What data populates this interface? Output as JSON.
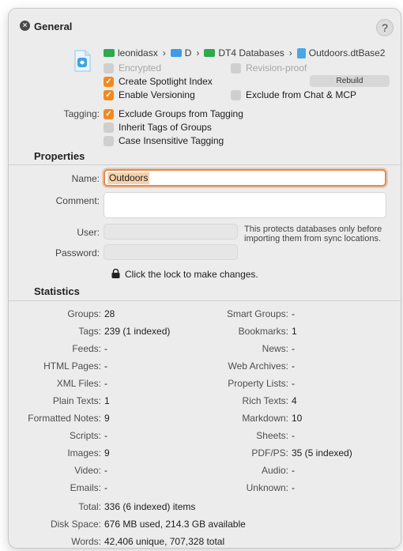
{
  "header": {
    "title": "General",
    "help": "?",
    "close": "×"
  },
  "path": {
    "items": [
      "leonidasx",
      "D",
      "DT4 Databases",
      "Outdoors.dtBase2"
    ],
    "separator": "›",
    "folder_colors": {
      "green": "#2fa84f",
      "blue": "#3d9be8"
    }
  },
  "options": {
    "encrypted": {
      "label": "Encrypted",
      "checked": false,
      "enabled": false
    },
    "revision_proof": {
      "label": "Revision-proof",
      "checked": false,
      "enabled": false
    },
    "spotlight": {
      "label": "Create Spotlight Index",
      "checked": true
    },
    "rebuild": "Rebuild",
    "versioning": {
      "label": "Enable Versioning",
      "checked": true
    },
    "exclude_chat": {
      "label": "Exclude from Chat & MCP",
      "checked": false
    }
  },
  "tagging": {
    "label": "Tagging:",
    "exclude_groups": {
      "label": "Exclude Groups from Tagging",
      "checked": true
    },
    "inherit_tags": {
      "label": "Inherit Tags of Groups",
      "checked": false
    },
    "case_insensitive": {
      "label": "Case Insensitive Tagging",
      "checked": false
    }
  },
  "properties": {
    "title": "Properties",
    "name_label": "Name:",
    "name_value": "Outdoors",
    "comment_label": "Comment:",
    "comment_value": "",
    "user_label": "User:",
    "password_label": "Password:",
    "note": "This protects databases only before importing them from sync locations.",
    "lock_text": "Click the lock to make changes."
  },
  "statistics": {
    "title": "Statistics",
    "left": [
      {
        "label": "Groups:",
        "value": "28"
      },
      {
        "label": "Tags:",
        "value": "239 (1 indexed)"
      },
      {
        "label": "Feeds:",
        "value": "-"
      },
      {
        "label": "HTML Pages:",
        "value": "-"
      },
      {
        "label": "XML Files:",
        "value": "-"
      },
      {
        "label": "Plain Texts:",
        "value": "1"
      },
      {
        "label": "Formatted Notes:",
        "value": "9"
      },
      {
        "label": "Scripts:",
        "value": "-"
      },
      {
        "label": "Images:",
        "value": "9"
      },
      {
        "label": "Video:",
        "value": "-"
      },
      {
        "label": "Emails:",
        "value": "-"
      }
    ],
    "right": [
      {
        "label": "Smart Groups:",
        "value": "-"
      },
      {
        "label": "Bookmarks:",
        "value": "1"
      },
      {
        "label": "News:",
        "value": "-"
      },
      {
        "label": "Web Archives:",
        "value": "-"
      },
      {
        "label": "Property Lists:",
        "value": "-"
      },
      {
        "label": "Rich Texts:",
        "value": "4"
      },
      {
        "label": "Markdown:",
        "value": "10"
      },
      {
        "label": "Sheets:",
        "value": "-"
      },
      {
        "label": "PDF/PS:",
        "value": "35 (5 indexed)"
      },
      {
        "label": "Audio:",
        "value": "-"
      },
      {
        "label": "Unknown:",
        "value": "-"
      }
    ],
    "totals": [
      {
        "label": "Total:",
        "value": "336 (6 indexed) items"
      },
      {
        "label": "Disk Space:",
        "value": "676 MB used, 214.3 GB available"
      },
      {
        "label": "Words:",
        "value": "42,406 unique, 707,328 total"
      }
    ]
  },
  "colors": {
    "accent": "#f2891f",
    "focus_ring": "#e08c4f",
    "selection": "#f7d1ad"
  }
}
